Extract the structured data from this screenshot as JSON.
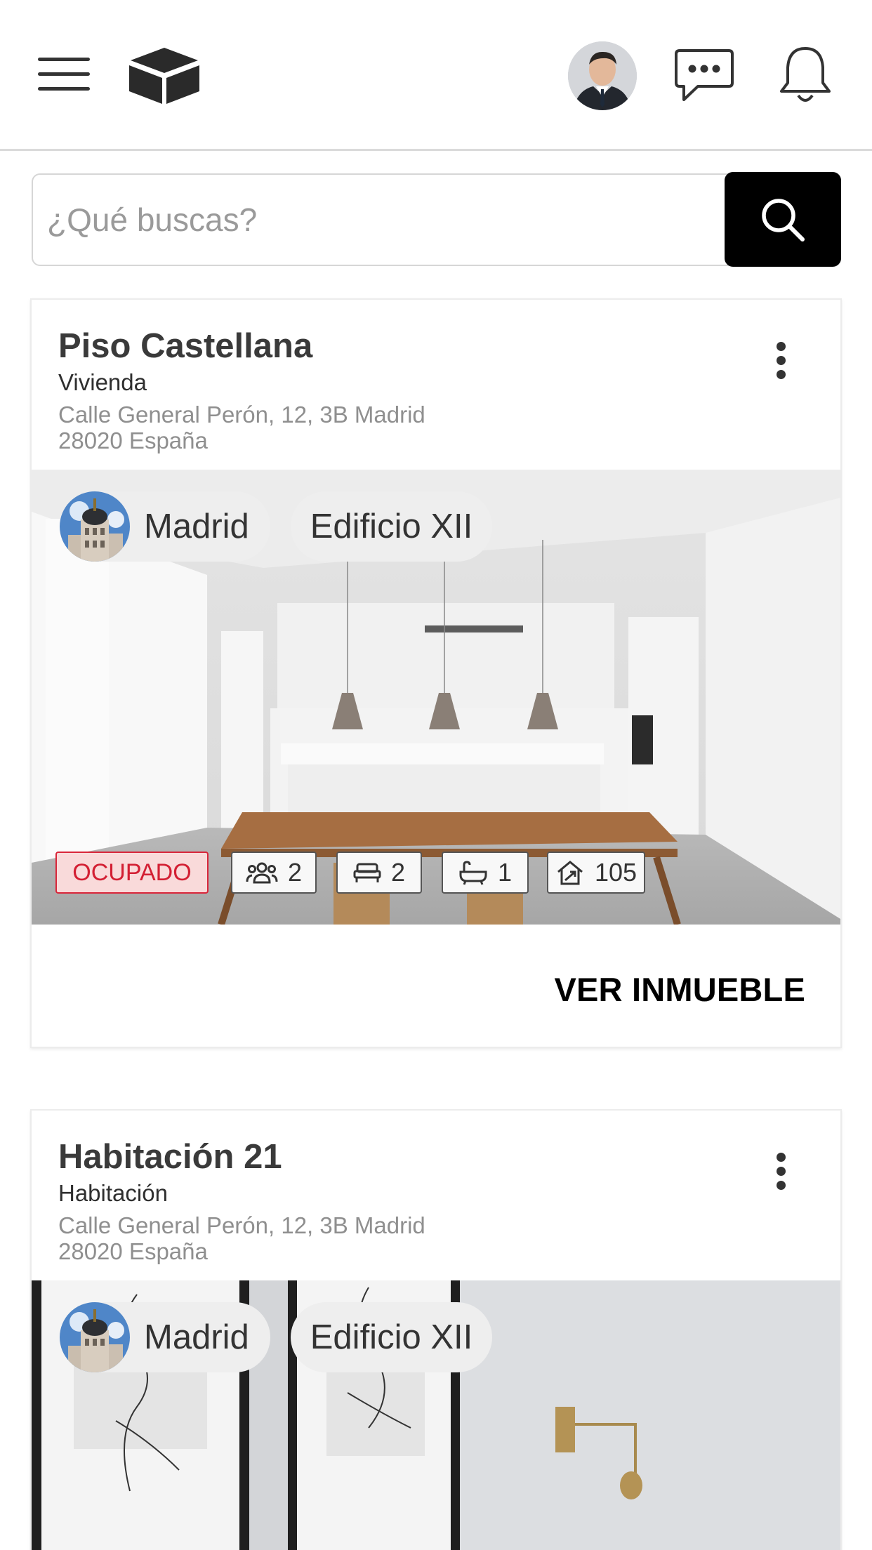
{
  "header": {
    "menu_icon": "hamburger-menu-icon",
    "logo_icon": "cube-logo-icon",
    "chat_icon": "chat-bubble-dots-icon",
    "bell_icon": "bell-icon"
  },
  "search": {
    "placeholder": "¿Qué buscas?",
    "value": "",
    "button_icon": "search-icon"
  },
  "listings": [
    {
      "title": "Piso Castellana",
      "type": "Vivienda",
      "address_line1": "Calle General Perón, 12, 3B Madrid",
      "address_line2": "28020 España",
      "city": "Madrid",
      "building": "Edificio XII",
      "status": "OCUPADO",
      "stats": {
        "people": "2",
        "beds": "2",
        "baths": "1",
        "area": "105"
      },
      "action": "VER INMUEBLE"
    },
    {
      "title": "Habitación 21",
      "type": "Habitación",
      "address_line1": "Calle General Perón, 12, 3B Madrid",
      "address_line2": "28020 España",
      "city": "Madrid",
      "building": "Edificio XII"
    }
  ],
  "colors": {
    "primary": "#000000",
    "status_occupied": "#d31f33",
    "status_occupied_bg": "#f9dada",
    "chip_bg": "#eeeeee"
  }
}
